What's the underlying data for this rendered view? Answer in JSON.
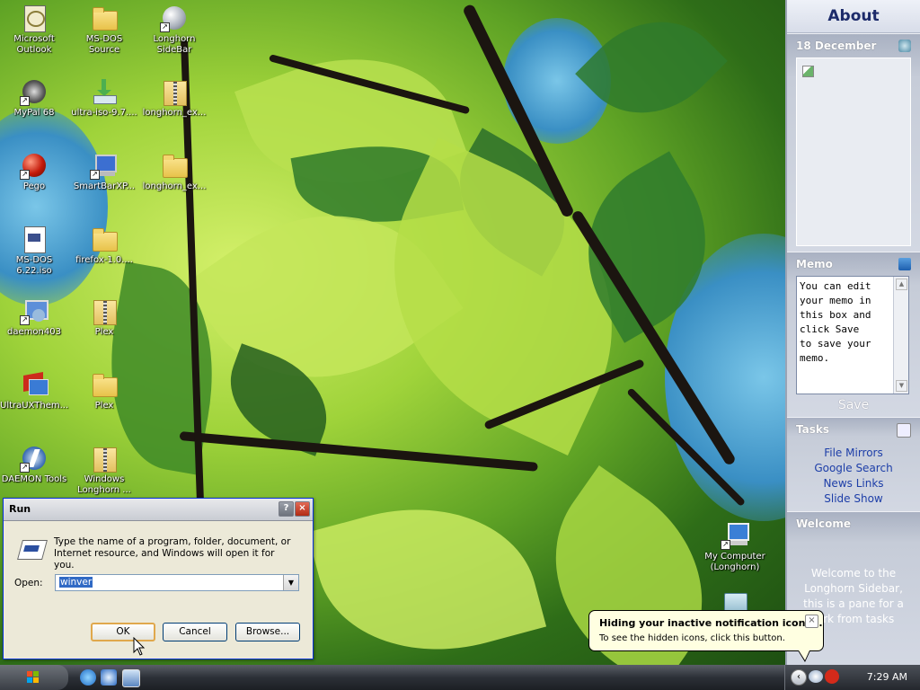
{
  "desktop_icons": [
    {
      "label": "Microsoft\nOutlook",
      "icon": "outlook-icon"
    },
    {
      "label": "MS-DOS\nSource",
      "icon": "folder-icon"
    },
    {
      "label": "Longhorn\nSideBar",
      "icon": "globe-icon"
    },
    {
      "label": "MyPal 68",
      "icon": "raccoon-icon"
    },
    {
      "label": "ultra-iso-9.7....",
      "icon": "download-icon"
    },
    {
      "label": "longhorn_ex...",
      "icon": "zip-folder-icon"
    },
    {
      "label": "Pego",
      "icon": "red-ball-icon"
    },
    {
      "label": "SmartBarXP...",
      "icon": "computer-icon"
    },
    {
      "label": "longhorn_ex...",
      "icon": "folder-icon"
    },
    {
      "label": "MS-DOS\n6.22.iso",
      "icon": "iso-icon"
    },
    {
      "label": "firefox-1.0....",
      "icon": "folder-icon"
    },
    {
      "label": "daemon403",
      "icon": "installer-icon"
    },
    {
      "label": "Plex",
      "icon": "zip-folder-icon"
    },
    {
      "label": "UltraUXThem...",
      "icon": "theme-icon"
    },
    {
      "label": "Plex",
      "icon": "folder-icon"
    },
    {
      "label": "DAEMON Tools",
      "icon": "daemon-icon"
    },
    {
      "label": "Windows\nLonghorn ...",
      "icon": "zip-folder-icon"
    },
    {
      "label": "My Computer\n(Longhorn)",
      "icon": "my-computer-icon"
    }
  ],
  "sidebar": {
    "header": "About",
    "calendar": {
      "title": "18 December"
    },
    "memo": {
      "title": "Memo",
      "text": "You can edit\nyour memo in\nthis box and\nclick Save\nto save your\nmemo.",
      "save_label": "Save"
    },
    "tasks": {
      "title": "Tasks",
      "items": [
        "File Mirrors",
        "Google Search",
        "News Links",
        "Slide Show"
      ]
    },
    "welcome": {
      "title": "Welcome",
      "text": "Welcome to the Longhorn Sidebar, this is a pane for a ...rk from tasks"
    }
  },
  "run_dialog": {
    "title": "Run",
    "help_label": "?",
    "close_label": "×",
    "description": "Type the name of a program, folder, document, or Internet resource, and Windows will open it for you.",
    "open_label": "Open:",
    "input_value": "winver",
    "ok_label": "OK",
    "cancel_label": "Cancel",
    "browse_label": "Browse..."
  },
  "balloon": {
    "title": "Hiding your inactive notification icons...",
    "text": "To see the hidden icons, click this button.",
    "close_label": "×"
  },
  "taskbar": {
    "clock": "7:29 AM"
  }
}
